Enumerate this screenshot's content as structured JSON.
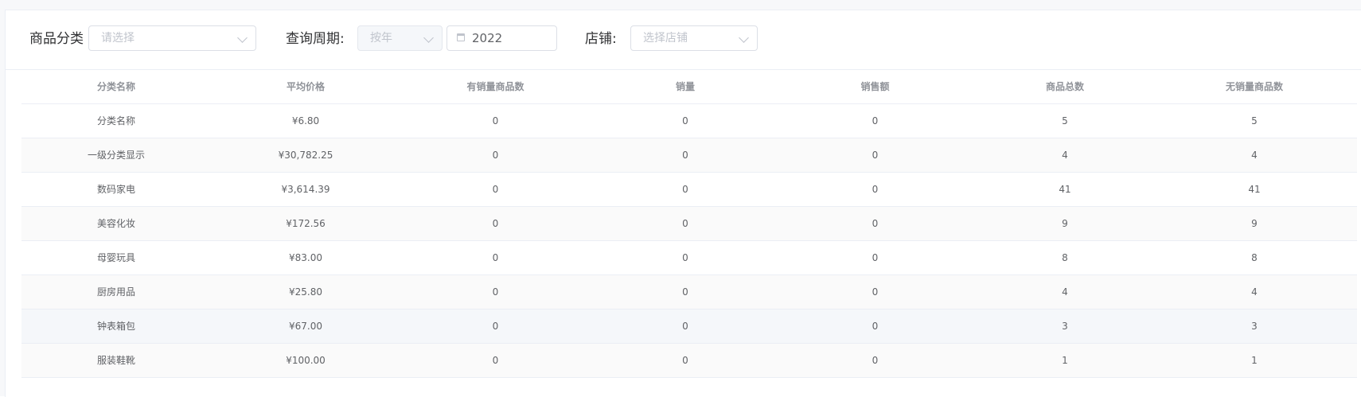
{
  "filters": {
    "category_label": "商品分类",
    "category_placeholder": "请选择",
    "period_label": "查询周期:",
    "period_type_placeholder": "按年",
    "period_year_value": "2022",
    "store_label": "店铺:",
    "store_placeholder": "选择店铺"
  },
  "table": {
    "columns": [
      "分类名称",
      "平均价格",
      "有销量商品数",
      "销量",
      "销售额",
      "商品总数",
      "无销量商品数"
    ],
    "rows": [
      [
        "分类名称",
        "¥6.80",
        "0",
        "0",
        "0",
        "5",
        "5"
      ],
      [
        "一级分类显示",
        "¥30,782.25",
        "0",
        "0",
        "0",
        "4",
        "4"
      ],
      [
        "数码家电",
        "¥3,614.39",
        "0",
        "0",
        "0",
        "41",
        "41"
      ],
      [
        "美容化妆",
        "¥172.56",
        "0",
        "0",
        "0",
        "9",
        "9"
      ],
      [
        "母婴玩具",
        "¥83.00",
        "0",
        "0",
        "0",
        "8",
        "8"
      ],
      [
        "厨房用品",
        "¥25.80",
        "0",
        "0",
        "0",
        "4",
        "4"
      ],
      [
        "钟表箱包",
        "¥67.00",
        "0",
        "0",
        "0",
        "3",
        "3"
      ],
      [
        "服装鞋靴",
        "¥100.00",
        "0",
        "0",
        "0",
        "1",
        "1"
      ]
    ]
  },
  "icons": {
    "calendar": "calendar-icon",
    "dropdown": "chevron-down-icon"
  }
}
